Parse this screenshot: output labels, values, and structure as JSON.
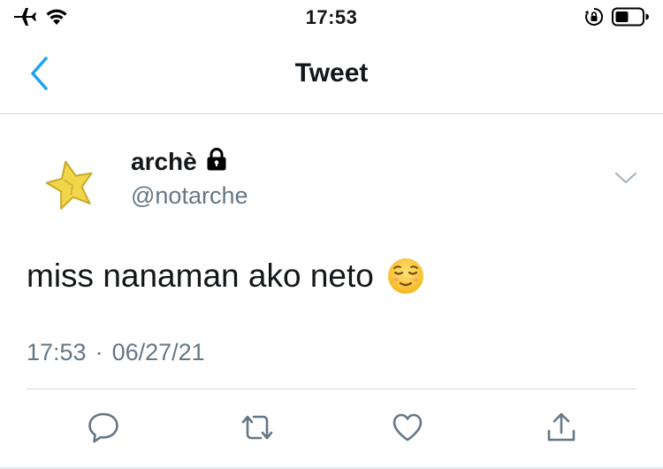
{
  "status_bar": {
    "time": "17:53",
    "icons": [
      "airplane-icon",
      "wifi-icon",
      "orientation-lock-icon",
      "battery-icon"
    ]
  },
  "nav": {
    "title": "Tweet",
    "back_icon": "chevron-left-icon"
  },
  "tweet": {
    "display_name": "archè",
    "handle": "@notarche",
    "text": "miss nanaman ako neto",
    "emoji": "relieved-face-emoji",
    "time": "17:53",
    "separator": "·",
    "date": "06/27/21",
    "protected_icon": "lock-icon",
    "more_icon": "chevron-down-icon"
  },
  "actions": [
    "reply-icon",
    "retweet-icon",
    "like-icon",
    "share-icon"
  ],
  "colors": {
    "accent": "#1da1f2",
    "muted": "#657786",
    "text": "#14171a",
    "divider": "#d4d6d8"
  }
}
